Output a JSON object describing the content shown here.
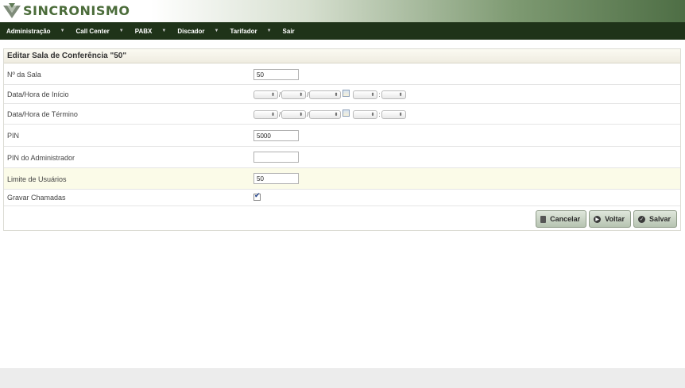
{
  "app": {
    "logo_text": "SINCRONISMO"
  },
  "nav": {
    "items": [
      {
        "label": "Administração",
        "has_menu": true
      },
      {
        "label": "Call Center",
        "has_menu": true
      },
      {
        "label": "PABX",
        "has_menu": true
      },
      {
        "label": "Discador",
        "has_menu": true
      },
      {
        "label": "Tarifador",
        "has_menu": true
      },
      {
        "label": "Sair",
        "has_menu": false
      }
    ]
  },
  "form": {
    "title": "Editar Sala de Conferência \"50\"",
    "room_number": {
      "label": "Nº da Sala",
      "value": "50"
    },
    "start_datetime": {
      "label": "Data/Hora de Início",
      "date_sep": "/",
      "time_sep": ":"
    },
    "end_datetime": {
      "label": "Data/Hora de Término",
      "date_sep": "/",
      "time_sep": ":"
    },
    "pin": {
      "label": "PIN",
      "value": "5000"
    },
    "admin_pin": {
      "label": "PIN do Administrador",
      "value": ""
    },
    "user_limit": {
      "label": "Limite de Usuários",
      "value": "50"
    },
    "record_calls": {
      "label": "Gravar Chamadas",
      "checked": true
    }
  },
  "buttons": {
    "cancel_label": "Cancelar",
    "back_label": "Voltar",
    "save_label": "Salvar"
  },
  "colors": {
    "nav_bg": "#1f3319",
    "brand_green": "#4b6c3a",
    "button_bg": "#c6d1c2",
    "highlight_row": "#fbfbe8"
  }
}
